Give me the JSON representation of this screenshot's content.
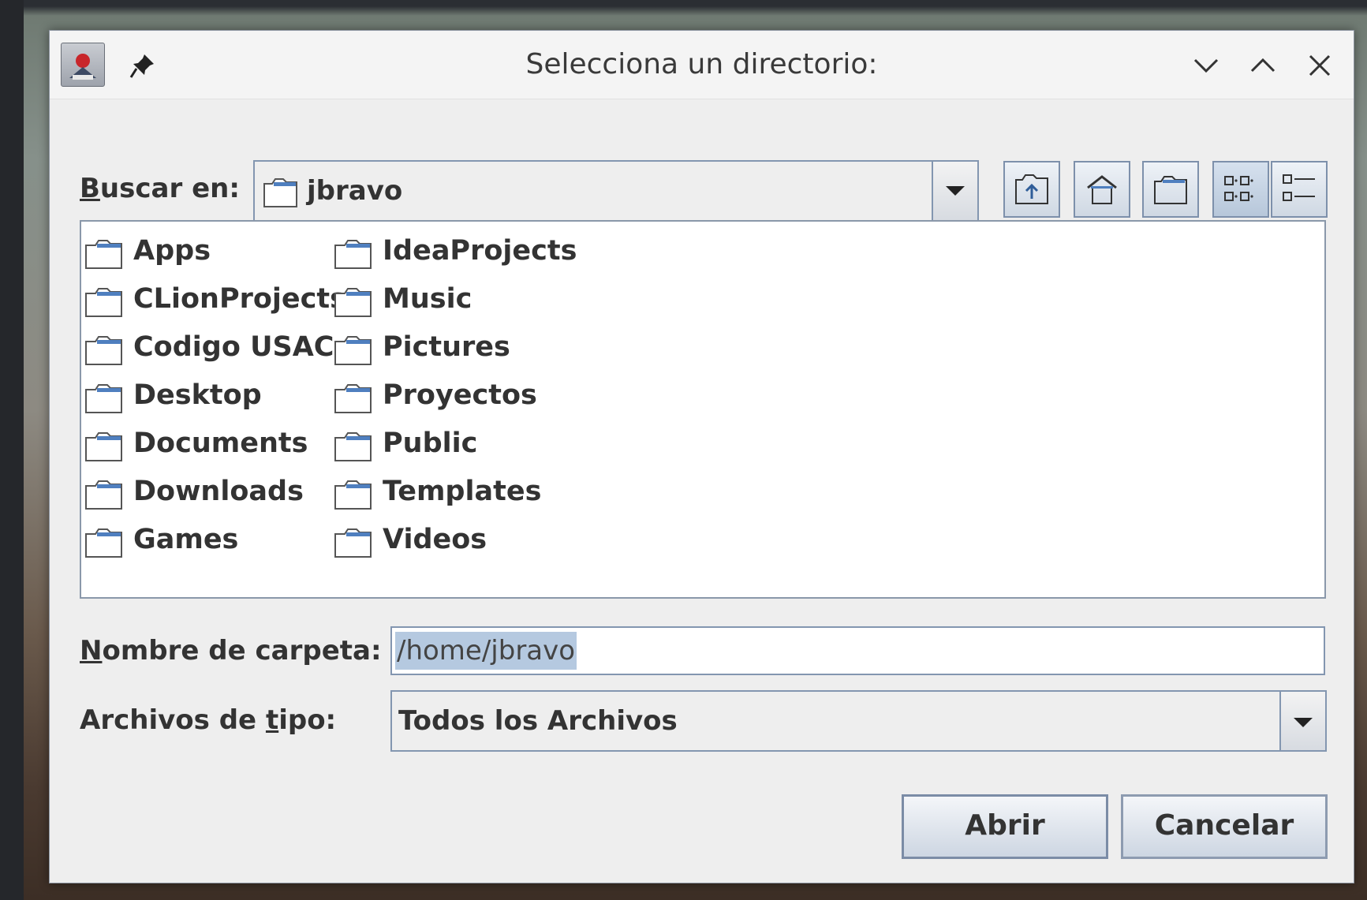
{
  "window": {
    "title": "Selecciona un directorio:",
    "controls": [
      "chevron-down-icon",
      "chevron-up-icon",
      "close-icon"
    ]
  },
  "look_in": {
    "label_underlined": "B",
    "label_rest": "uscar en:",
    "value": "jbravo"
  },
  "toolbar": {
    "buttons": [
      "up-folder-icon",
      "home-icon",
      "new-folder-icon",
      "list-view-icon",
      "details-view-icon"
    ],
    "active": "list-view-icon"
  },
  "files": {
    "column1": [
      "Apps",
      "CLionProjects",
      "Codigo USAC",
      "Desktop",
      "Documents",
      "Downloads",
      "Games"
    ],
    "column2": [
      "IdeaProjects",
      "Music",
      "Pictures",
      "Proyectos",
      "Public",
      "Templates",
      "Videos"
    ]
  },
  "folder_name": {
    "label_underlined": "N",
    "label_rest": "ombre de carpeta:",
    "value": "/home/jbravo"
  },
  "file_type": {
    "label_before": "Archivos de ",
    "label_underlined": "t",
    "label_after": "ipo:",
    "value": "Todos los Archivos"
  },
  "buttons": {
    "open": "Abrir",
    "cancel": "Cancelar"
  },
  "colors": {
    "accent_border": "#8396b0",
    "selection": "#b5c9e0",
    "folder_tab": "#4f7fbf"
  }
}
